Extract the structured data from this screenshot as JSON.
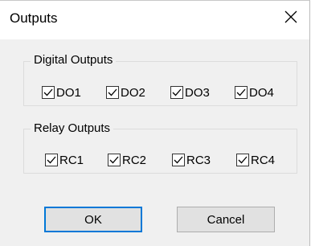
{
  "window": {
    "title": "Outputs"
  },
  "digital": {
    "legend": "Digital Outputs",
    "items": [
      {
        "label": "DO1",
        "checked": true
      },
      {
        "label": "DO2",
        "checked": true
      },
      {
        "label": "DO3",
        "checked": true
      },
      {
        "label": "DO4",
        "checked": true
      }
    ]
  },
  "relay": {
    "legend": "Relay Outputs",
    "items": [
      {
        "label": "RC1",
        "checked": true
      },
      {
        "label": "RC2",
        "checked": true
      },
      {
        "label": "RC3",
        "checked": true
      },
      {
        "label": "RC4",
        "checked": true
      }
    ]
  },
  "buttons": {
    "ok": "OK",
    "cancel": "Cancel"
  },
  "icons": {
    "close": "close-icon",
    "check": "check-icon"
  },
  "colors": {
    "accent": "#0078d7",
    "background": "#f0f0f0"
  }
}
